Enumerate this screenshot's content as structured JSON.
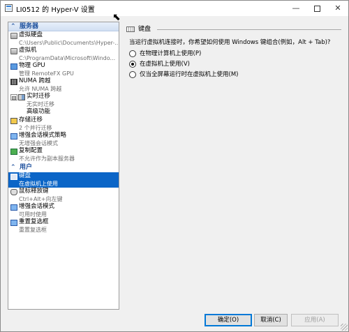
{
  "window": {
    "title": "LI0512 的 Hyper-V 设置",
    "min_glyph": "—",
    "close_glyph": "✕"
  },
  "tree": {
    "server_category": "服务器",
    "user_category": "用户",
    "server_items": [
      {
        "label": "虚拟硬盘",
        "sub": "C:\\Users\\Public\\Documents\\Hyper-..."
      },
      {
        "label": "虚拟机",
        "sub": "C:\\ProgramData\\Microsoft\\Windo..."
      },
      {
        "label": "物理 GPU",
        "sub": "管理 RemoteFX GPU"
      },
      {
        "label": "NUMA 跨越",
        "sub": "允许 NUMA 跨越"
      },
      {
        "label": "实时迁移",
        "sub": "无实时迁移"
      },
      {
        "label": "高级功能",
        "sub": ""
      },
      {
        "label": "存储迁移",
        "sub": "2 个并行迁移"
      },
      {
        "label": "增强会话模式策略",
        "sub": "无增强会话模式"
      },
      {
        "label": "复制配置",
        "sub": "不允许作为副本服务器"
      }
    ],
    "user_items": [
      {
        "label": "键盘",
        "sub": "在虚拟机上使用"
      },
      {
        "label": "鼠标释放键",
        "sub": "Ctrl+Alt+向左键"
      },
      {
        "label": "增强会话模式",
        "sub": "可用时使用"
      },
      {
        "label": "重置复选框",
        "sub": "重置复选框"
      }
    ],
    "expand_glyph": "⊟"
  },
  "content": {
    "section_title": "键盘",
    "prompt": "当运行虚拟机连接时，你希望如何使用 Windows 键组合(例如，Alt + Tab)?",
    "options": [
      {
        "label": "在物理计算机上使用(P)",
        "checked": false
      },
      {
        "label": "在虚拟机上使用(V)",
        "checked": true
      },
      {
        "label": "仅当全屏幕运行时在虚拟机上使用(M)",
        "checked": false
      }
    ]
  },
  "buttons": {
    "ok": "确定(O)",
    "cancel": "取消(C)",
    "apply": "应用(A)"
  }
}
